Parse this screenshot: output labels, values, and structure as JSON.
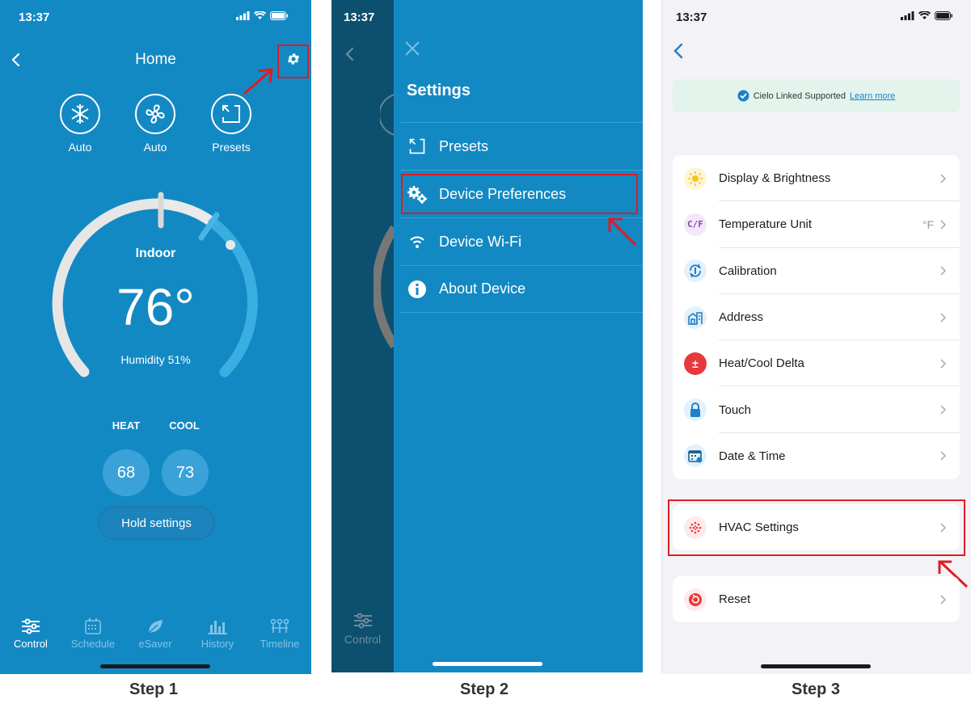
{
  "status": {
    "time": "13:37"
  },
  "step1": {
    "title": "Home",
    "modes": [
      {
        "label": "Auto",
        "icon": "snowflake-sun-icon"
      },
      {
        "label": "Auto",
        "icon": "fan-icon"
      },
      {
        "label": "Presets",
        "icon": "presets-icon"
      }
    ],
    "indoor_label": "Indoor",
    "temperature": "76°",
    "humidity": "Humidity 51%",
    "heat_label": "HEAT",
    "cool_label": "COOL",
    "heat_value": "68",
    "cool_value": "73",
    "hold_label": "Hold settings",
    "nav": [
      "Control",
      "Schedule",
      "eSaver",
      "History",
      "Timeline"
    ],
    "step_label": "Step 1"
  },
  "step2": {
    "settings_title": "Settings",
    "items": [
      {
        "label": "Presets",
        "icon": "presets-icon"
      },
      {
        "label": "Device Preferences",
        "icon": "gears-icon"
      },
      {
        "label": "Device Wi-Fi",
        "icon": "wifi-icon"
      },
      {
        "label": "About Device",
        "icon": "info-icon"
      }
    ],
    "bg_nav_label": "Control",
    "step_label": "Step 2"
  },
  "step3": {
    "banner_text": "Cielo Linked Supported",
    "banner_link": "Learn more",
    "rows": [
      {
        "label": "Display & Brightness",
        "value": "",
        "icon": "sun-icon"
      },
      {
        "label": "Temperature Unit",
        "value": "°F",
        "icon": "cf-icon",
        "icon_text": "C/F"
      },
      {
        "label": "Calibration",
        "value": "",
        "icon": "calibration-icon"
      },
      {
        "label": "Address",
        "value": "",
        "icon": "building-icon"
      },
      {
        "label": "Heat/Cool Delta",
        "value": "",
        "icon": "delta-icon",
        "icon_text": "±"
      },
      {
        "label": "Touch",
        "value": "",
        "icon": "lock-icon"
      },
      {
        "label": "Date & Time",
        "value": "",
        "icon": "calendar-icon"
      }
    ],
    "hvac_label": "HVAC Settings",
    "reset_label": "Reset",
    "step_label": "Step 3"
  },
  "colors": {
    "app_blue": "#1389c4",
    "annotation_red": "#e01b24",
    "ios_accent": "#1f7fc9"
  }
}
